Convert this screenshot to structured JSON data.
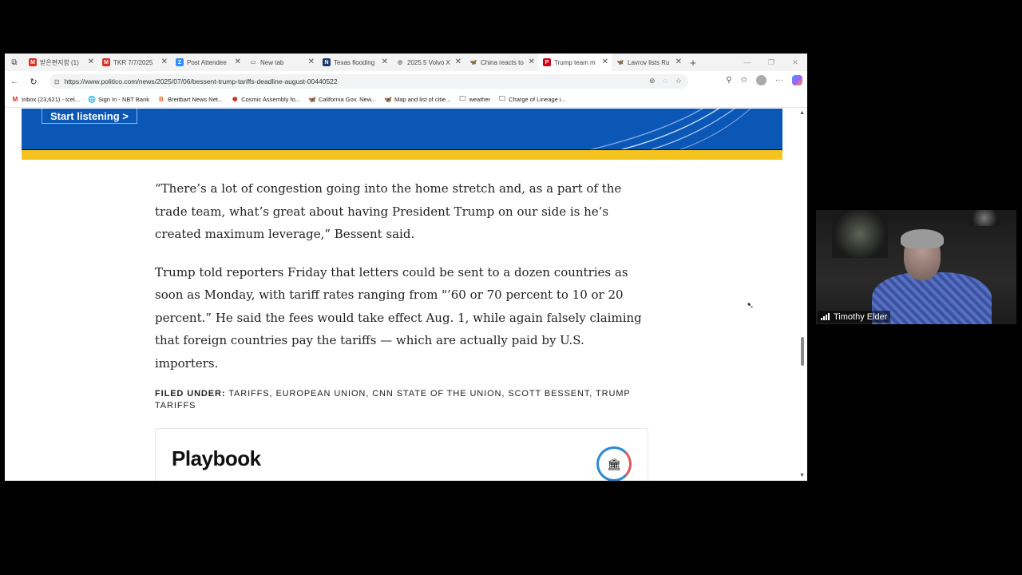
{
  "tabs": [
    {
      "label": "받은편지함 (1)",
      "icon": "gmail-icon",
      "color": "#d93025",
      "glyph": "M",
      "active": false
    },
    {
      "label": "TKR 7/7/2025",
      "icon": "gmail-icon",
      "color": "#d93025",
      "glyph": "M",
      "active": false
    },
    {
      "label": "Post Attendee",
      "icon": "zoom-icon",
      "color": "#2d8cff",
      "glyph": "Z",
      "active": false
    },
    {
      "label": "New tab",
      "icon": "newtab-icon",
      "color": "#888888",
      "glyph": "▭",
      "active": false
    },
    {
      "label": "Texas flooding",
      "icon": "news-icon",
      "color": "#1a3b6d",
      "glyph": "N",
      "active": false
    },
    {
      "label": "2025.5 Volvo X",
      "icon": "web-icon",
      "color": "#555555",
      "glyph": "◎",
      "active": false
    },
    {
      "label": "China reacts to",
      "icon": "butterfly-icon",
      "color": "#1185fe",
      "glyph": "🦋",
      "active": false
    },
    {
      "label": "Trump team m",
      "icon": "politico-icon",
      "color": "#d0021b",
      "glyph": "P",
      "active": true
    },
    {
      "label": "Lavrov lists Ru",
      "icon": "butterfly-icon",
      "color": "#1185fe",
      "glyph": "🦋",
      "active": false
    }
  ],
  "address": {
    "url": "https://www.politico.com/news/2025/07/06/bessent-trump-tariffs-deadline-august-00440522"
  },
  "bookmarks": [
    {
      "label": "Inbox (23,621) - tcel...",
      "icon": "gmail-icon",
      "glyph": "M",
      "color": "#d93025"
    },
    {
      "label": "Sign In - NBT Bank",
      "icon": "globe-icon",
      "glyph": "🌐",
      "color": "#444444"
    },
    {
      "label": "Breitbart News Net...",
      "icon": "breitbart-icon",
      "glyph": "B",
      "color": "#e45f1a"
    },
    {
      "label": "Cosmic Assembly fo...",
      "icon": "cosmic-icon",
      "glyph": "✺",
      "color": "#c0392b"
    },
    {
      "label": "California Gov. New...",
      "icon": "butterfly-icon",
      "glyph": "🦋",
      "color": "#1185fe"
    },
    {
      "label": "Map and list of citie...",
      "icon": "butterfly-icon",
      "glyph": "🦋",
      "color": "#1185fe"
    },
    {
      "label": "weather",
      "icon": "folder-icon",
      "glyph": "🗀",
      "color": "#555555"
    },
    {
      "label": "Charge of Lineage i...",
      "icon": "folder-icon",
      "glyph": "🗀",
      "color": "#555555"
    }
  ],
  "banner": {
    "button_label": "Start listening >"
  },
  "article": {
    "paragraph_1": "“There’s a lot of congestion going into the home stretch and, as a part of the trade team, what’s great about having President Trump on our side is he’s created maximum leverage,” Bessent said.",
    "paragraph_2": "Trump told reporters Friday that letters could be sent to a dozen countries as soon as Monday, with tariff rates ranging from \"’60 or 70 percent to 10 or 20 percent.” He said the fees would take effect Aug. 1, while again falsely claiming that foreign countries pay the tariffs — which are actually paid by U.S. importers.",
    "filed_under_label": "FILED UNDER:",
    "filed_under_tags": [
      "TARIFFS",
      "EUROPEAN UNION",
      "CNN STATE OF THE UNION",
      "SCOTT BESSENT",
      "TRUMP TARIFFS"
    ]
  },
  "promo": {
    "title": "Playbook"
  },
  "video": {
    "participant_name": "Timothy Elder"
  },
  "colors": {
    "banner_blue": "#0a57b6",
    "banner_stripe": "#f4c31f",
    "page_bg": "#000000"
  }
}
